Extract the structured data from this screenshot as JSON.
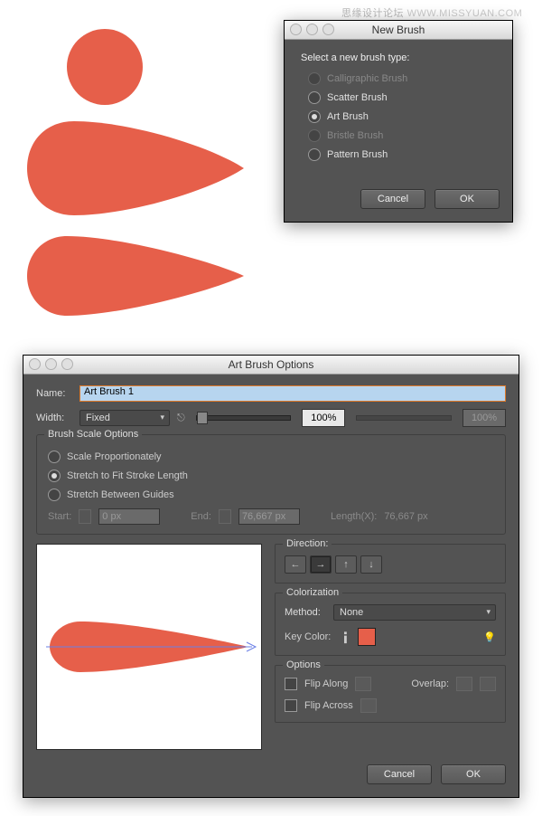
{
  "watermark": {
    "cn": "思缘设计论坛",
    "en": "WWW.MISSYUAN.COM"
  },
  "newBrush": {
    "title": "New Brush",
    "heading": "Select a new brush type:",
    "options": [
      {
        "label": "Calligraphic Brush",
        "selected": false,
        "disabled": true
      },
      {
        "label": "Scatter Brush",
        "selected": false,
        "disabled": false
      },
      {
        "label": "Art Brush",
        "selected": true,
        "disabled": false
      },
      {
        "label": "Bristle Brush",
        "selected": false,
        "disabled": true
      },
      {
        "label": "Pattern Brush",
        "selected": false,
        "disabled": false
      }
    ],
    "cancel": "Cancel",
    "ok": "OK"
  },
  "artBrush": {
    "title": "Art Brush Options",
    "nameLabel": "Name:",
    "nameValue": "Art Brush 1",
    "widthLabel": "Width:",
    "widthType": "Fixed",
    "widthPct": "100%",
    "widthPct2": "100%",
    "scale": {
      "legend": "Brush Scale Options",
      "opt1": "Scale Proportionately",
      "opt2": "Stretch to Fit Stroke Length",
      "opt3": "Stretch Between Guides",
      "startLabel": "Start:",
      "startValue": "0 px",
      "endLabel": "End:",
      "endValue": "76,667 px",
      "lengthLabel": "Length(X):",
      "lengthValue": "76,667 px"
    },
    "direction": {
      "legend": "Direction:",
      "arrows": [
        "←",
        "→",
        "↑",
        "↓"
      ]
    },
    "colorization": {
      "legend": "Colorization",
      "methodLabel": "Method:",
      "methodValue": "None",
      "keyColorLabel": "Key Color:"
    },
    "options": {
      "legend": "Options",
      "flipAlong": "Flip Along",
      "flipAcross": "Flip Across",
      "overlapLabel": "Overlap:"
    },
    "cancel": "Cancel",
    "ok": "OK"
  }
}
